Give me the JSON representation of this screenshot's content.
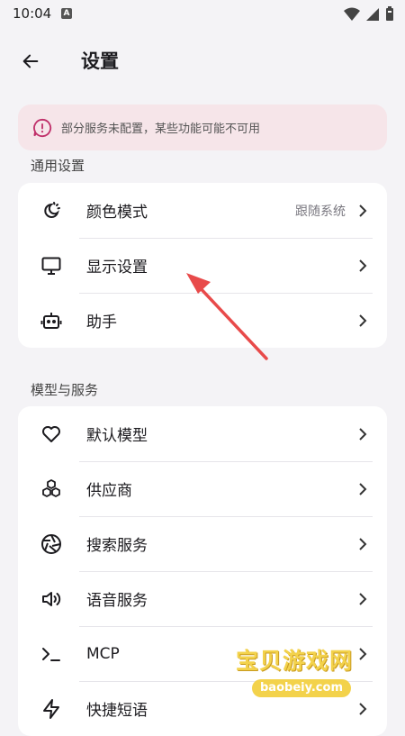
{
  "status_bar": {
    "time": "10:04",
    "notification_glyph": "A"
  },
  "header": {
    "title": "设置"
  },
  "warning": {
    "text": "部分服务未配置，某些功能可能不可用"
  },
  "sections": {
    "general": {
      "title": "通用设置",
      "items": [
        {
          "label": "颜色模式",
          "value": "跟随系统",
          "icon": "palette-icon"
        },
        {
          "label": "显示设置",
          "icon": "monitor-icon"
        },
        {
          "label": "助手",
          "icon": "robot-icon"
        }
      ]
    },
    "models": {
      "title": "模型与服务",
      "items": [
        {
          "label": "默认模型",
          "icon": "heart-icon"
        },
        {
          "label": "供应商",
          "icon": "boxes-icon"
        },
        {
          "label": "搜索服务",
          "icon": "aperture-icon"
        },
        {
          "label": "语音服务",
          "icon": "speaker-icon"
        },
        {
          "label": "MCP",
          "icon": "terminal-icon"
        },
        {
          "label": "快捷短语",
          "icon": "lightning-icon"
        }
      ]
    }
  },
  "watermark": {
    "text": "宝贝游戏网",
    "url": "baobeiy.com"
  },
  "colors": {
    "accent_warning": "#c0306a",
    "annotation_arrow": "#e84a4a",
    "background": "#f4f3f6"
  }
}
